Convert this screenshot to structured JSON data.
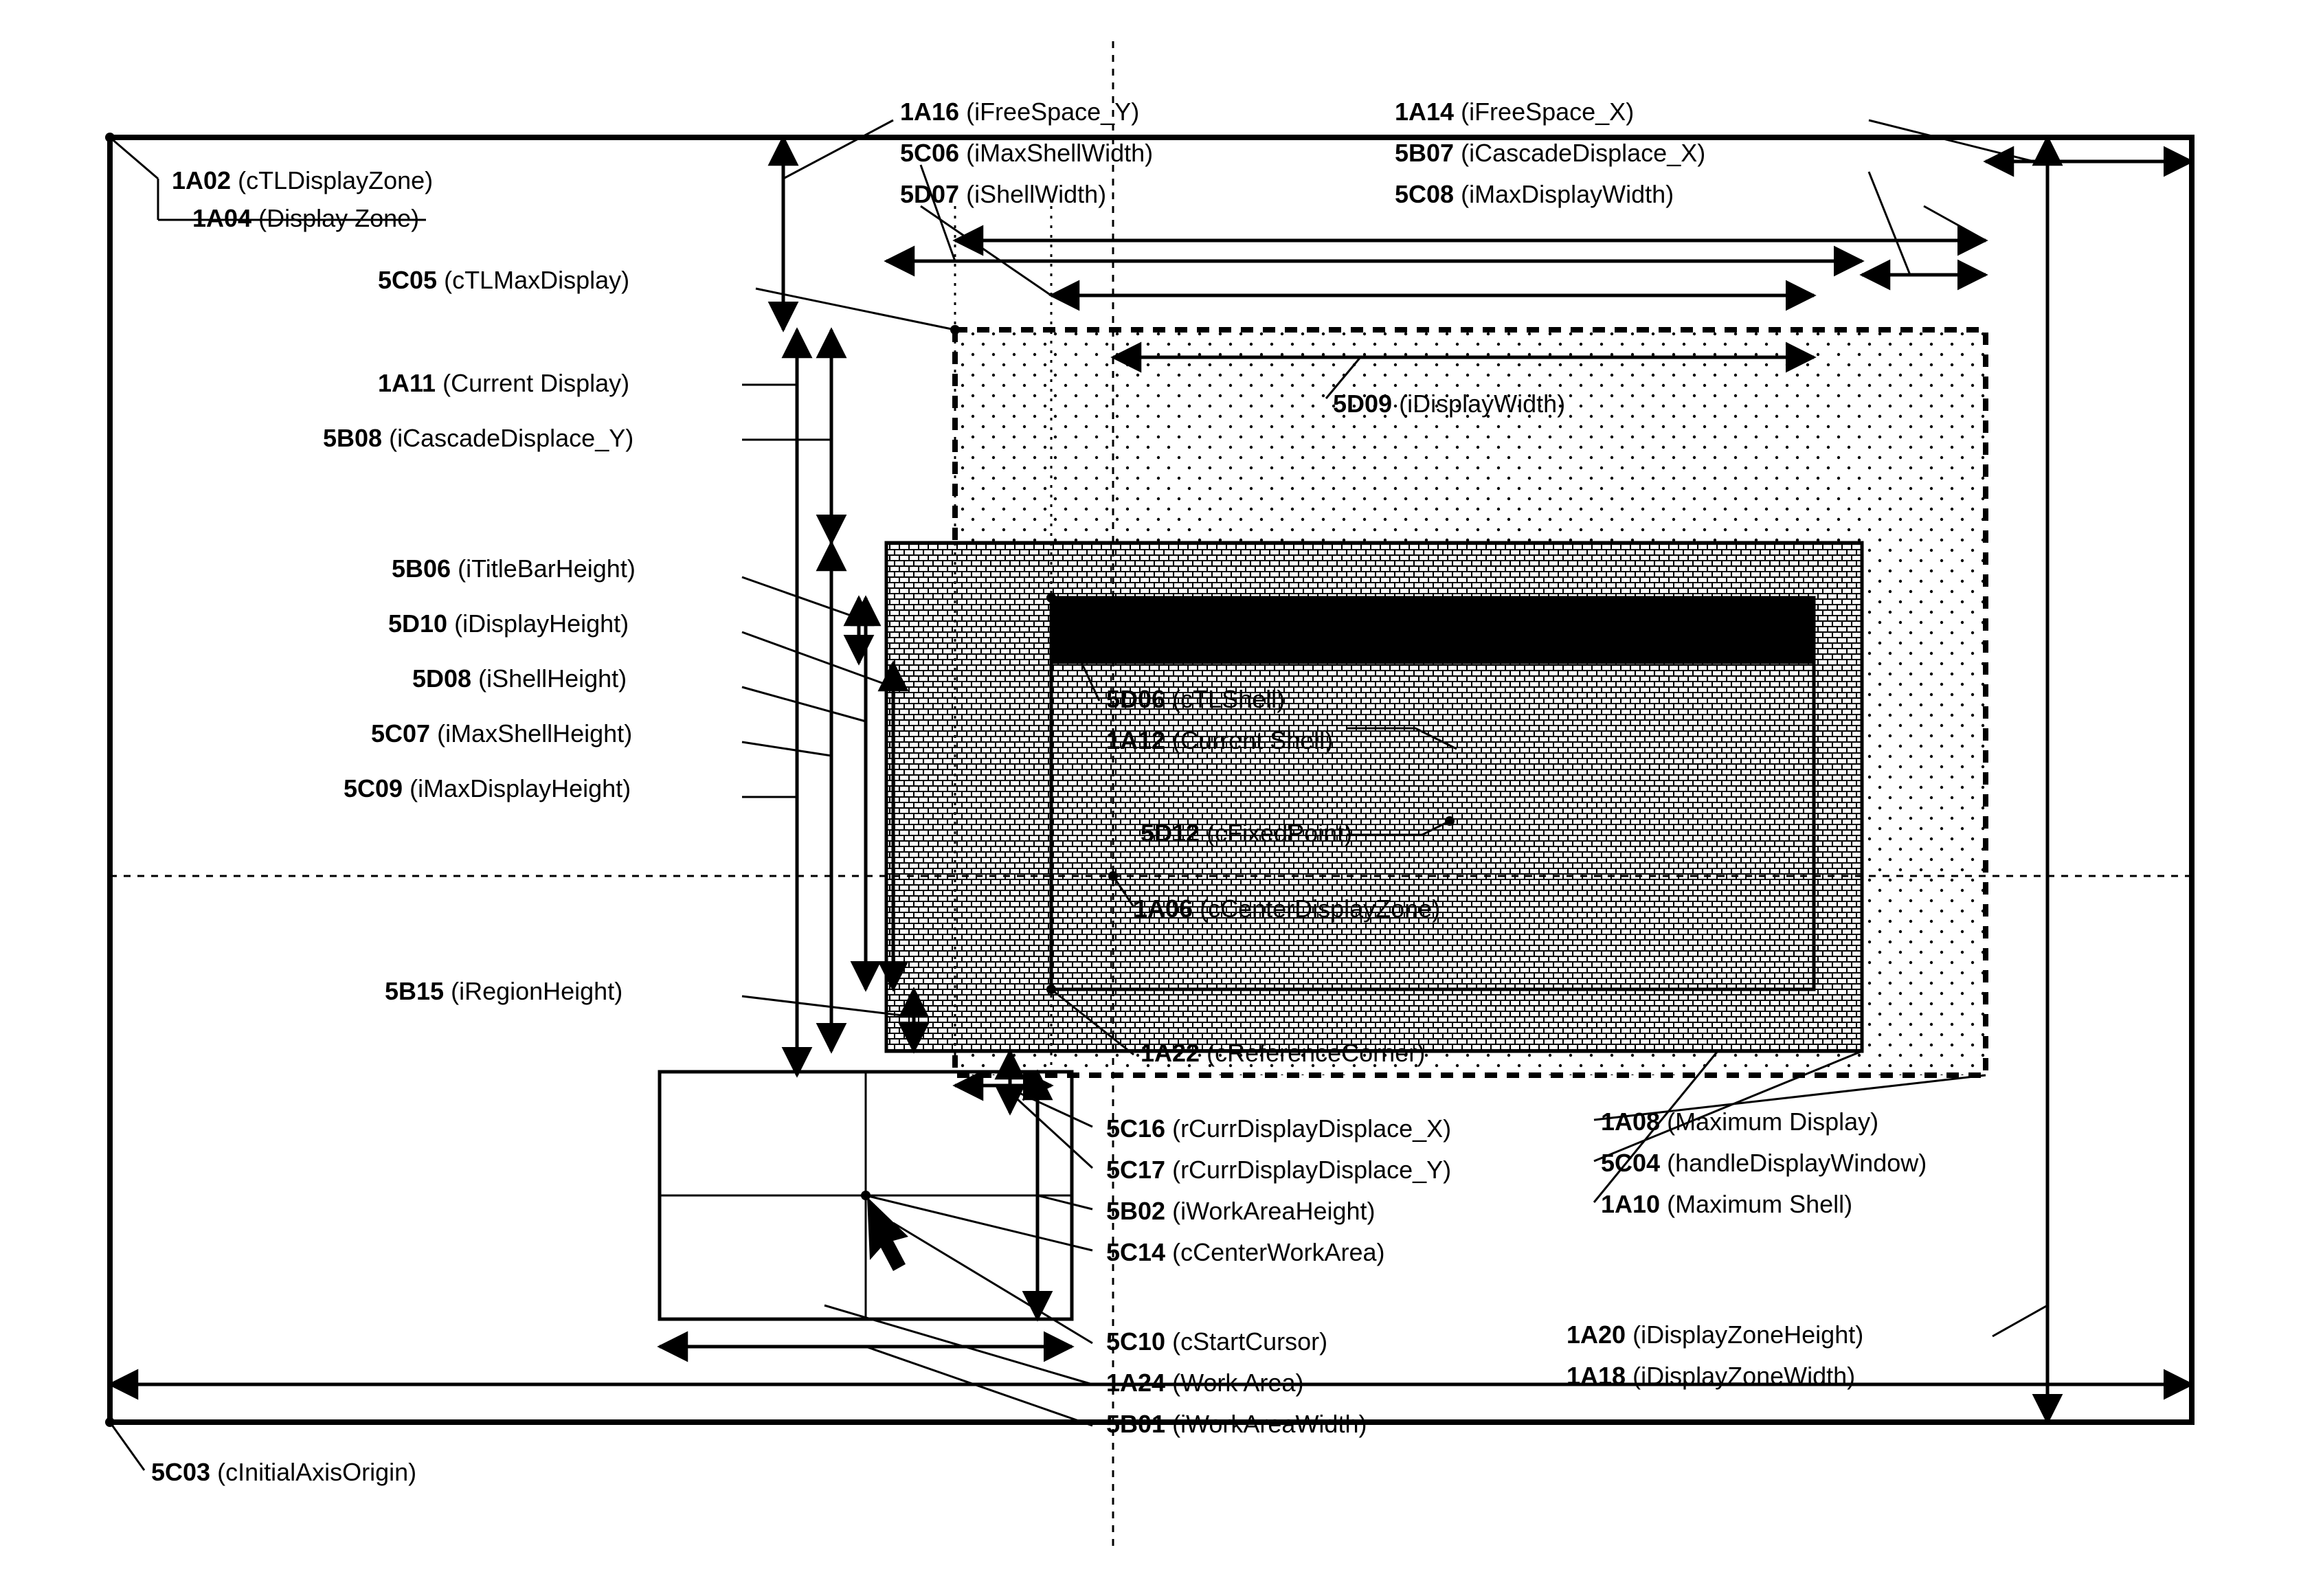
{
  "labels": {
    "l1A02": {
      "id": "1A02",
      "desc": "(cTLDisplayZone)"
    },
    "l1A04": {
      "id": "1A04",
      "desc": "(Display Zone)"
    },
    "l1A16": {
      "id": "1A16",
      "desc": "(iFreeSpace_Y)"
    },
    "l1A14": {
      "id": "1A14",
      "desc": "(iFreeSpace_X)"
    },
    "l5C06": {
      "id": "5C06",
      "desc": "(iMaxShellWidth)"
    },
    "l5B07": {
      "id": "5B07",
      "desc": "(iCascadeDisplace_X)"
    },
    "l5D07": {
      "id": "5D07",
      "desc": "(iShellWidth)"
    },
    "l5C08": {
      "id": "5C08",
      "desc": "(iMaxDisplayWidth)"
    },
    "l5C05": {
      "id": "5C05",
      "desc": "(cTLMaxDisplay)"
    },
    "l1A11": {
      "id": "1A11",
      "desc": "(Current Display)"
    },
    "l5B08": {
      "id": "5B08",
      "desc": "(iCascadeDisplace_Y)"
    },
    "l5B06": {
      "id": "5B06",
      "desc": "(iTitleBarHeight)"
    },
    "l5D10": {
      "id": "5D10",
      "desc": "(iDisplayHeight)"
    },
    "l5D08": {
      "id": "5D08",
      "desc": "(iShellHeight)"
    },
    "l5C07": {
      "id": "5C07",
      "desc": "(iMaxShellHeight)"
    },
    "l5C09": {
      "id": "5C09",
      "desc": "(iMaxDisplayHeight)"
    },
    "l5B15": {
      "id": "5B15",
      "desc": "(iRegionHeight)"
    },
    "l5D09": {
      "id": "5D09",
      "desc": "(iDisplayWidth)"
    },
    "l5D06": {
      "id": "5D06",
      "desc": "(cTLShell)"
    },
    "l1A12": {
      "id": "1A12",
      "desc": "(Current Shell)"
    },
    "l5D12": {
      "id": "5D12",
      "desc": "(cFixedPoint)"
    },
    "l1A06": {
      "id": "1A06",
      "desc": "(cCenterDisplayZone)"
    },
    "l1A22": {
      "id": "1A22",
      "desc": "(cReferenceCorner)"
    },
    "l5C16": {
      "id": "5C16",
      "desc": "(rCurrDisplayDisplace_X)"
    },
    "l5C17": {
      "id": "5C17",
      "desc": "(rCurrDisplayDisplace_Y)"
    },
    "l5B02": {
      "id": "5B02",
      "desc": "(iWorkAreaHeight)"
    },
    "l5C14": {
      "id": "5C14",
      "desc": "(cCenterWorkArea)"
    },
    "l5C10": {
      "id": "5C10",
      "desc": "(cStartCursor)"
    },
    "l1A24": {
      "id": "1A24",
      "desc": "(Work Area)"
    },
    "l5B01": {
      "id": "5B01",
      "desc": "(iWorkAreaWidth)"
    },
    "l5C03": {
      "id": "5C03",
      "desc": "(cInitialAxisOrigin)"
    },
    "l1A08": {
      "id": "1A08",
      "desc": "(Maximum Display)"
    },
    "l5C04": {
      "id": "5C04",
      "desc": "(handleDisplayWindow)"
    },
    "l1A10": {
      "id": "1A10",
      "desc": "(Maximum Shell)"
    },
    "l1A20": {
      "id": "1A20",
      "desc": "(iDisplayZoneHeight)"
    },
    "l1A18": {
      "id": "1A18",
      "desc": "(iDisplayZoneWidth)"
    }
  }
}
